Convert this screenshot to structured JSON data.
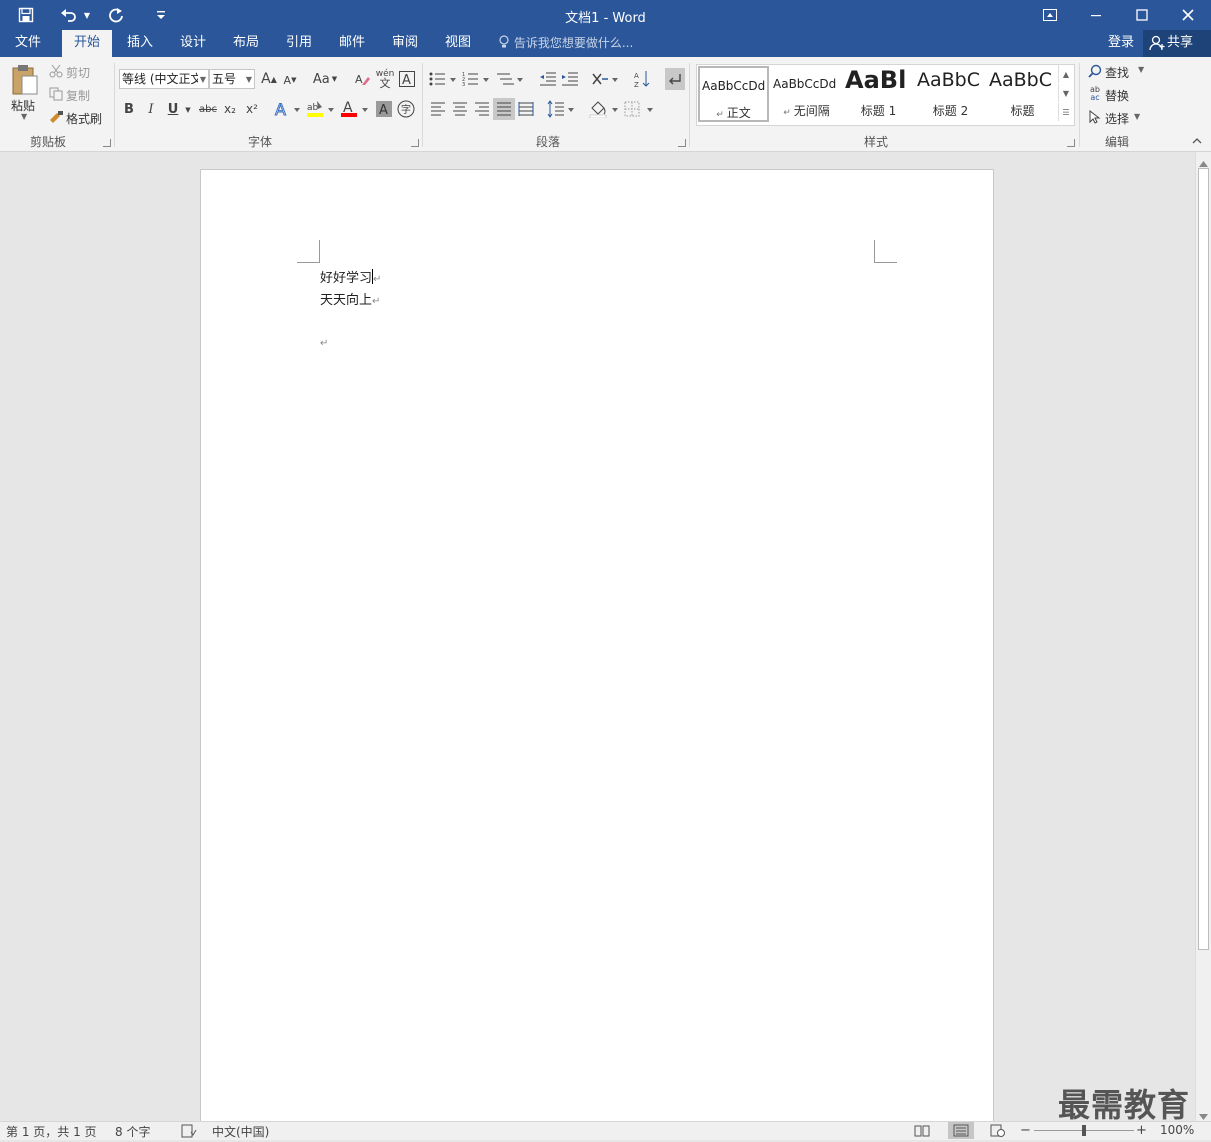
{
  "window": {
    "title": "文档1 - Word",
    "save_icon": "save-icon",
    "undo_icon": "undo-icon",
    "redo_icon": "redo-icon",
    "customize_icon": "customize-qat-icon",
    "ribbon_display_icon": "ribbon-display-options-icon",
    "minimize_icon": "minimize-icon",
    "maximize_icon": "maximize-icon",
    "close_icon": "close-icon"
  },
  "tabs": [
    {
      "label": "文件",
      "active": false
    },
    {
      "label": "开始",
      "active": true
    },
    {
      "label": "插入",
      "active": false
    },
    {
      "label": "设计",
      "active": false
    },
    {
      "label": "布局",
      "active": false
    },
    {
      "label": "引用",
      "active": false
    },
    {
      "label": "邮件",
      "active": false
    },
    {
      "label": "审阅",
      "active": false
    },
    {
      "label": "视图",
      "active": false
    }
  ],
  "tell_me": {
    "placeholder": "告诉我您想要做什么..."
  },
  "account": {
    "signin": "登录",
    "share": "共享"
  },
  "clipboard": {
    "group_label": "剪贴板",
    "paste": "粘贴",
    "cut": "剪切",
    "copy": "复制",
    "format_painter": "格式刷"
  },
  "font": {
    "group_label": "字体",
    "font_name": "等线 (中文正文)",
    "font_size": "五号",
    "grow": "A",
    "shrink": "A",
    "change_case": "Aa",
    "bold": "B",
    "italic": "I",
    "underline": "U",
    "strikethrough": "abc",
    "subscript": "x₂",
    "superscript": "x²"
  },
  "paragraph": {
    "group_label": "段落"
  },
  "styles": {
    "group_label": "样式",
    "items": [
      {
        "preview": "AaBbCcDd",
        "name": "正文",
        "selected": true
      },
      {
        "preview": "AaBbCcDd",
        "name": "无间隔",
        "selected": false
      },
      {
        "preview": "AaBl",
        "name": "标题 1",
        "selected": false
      },
      {
        "preview": "AaBbC",
        "name": "标题 2",
        "selected": false
      },
      {
        "preview": "AaBbC",
        "name": "标题",
        "selected": false
      }
    ]
  },
  "editing": {
    "group_label": "编辑",
    "find": "查找",
    "replace": "替换",
    "select": "选择"
  },
  "document": {
    "lines": [
      "好好学习",
      "天天向上",
      ""
    ],
    "paragraph_mark": "↵"
  },
  "status": {
    "page": "第 1 页，共 1 页",
    "words": "8 个字",
    "language": "中文(中国)",
    "zoom": "100%",
    "zoom_level": 1.0,
    "zoom_minus": "−",
    "zoom_plus": "+"
  },
  "watermark": "最需教育",
  "colors": {
    "title_bar": "#2b579a",
    "ribbon_bg": "#f3f3f3",
    "canvas_bg": "#e6e6e6",
    "highlight_yellow": "#ffff00",
    "font_color_red": "#ff0000"
  }
}
